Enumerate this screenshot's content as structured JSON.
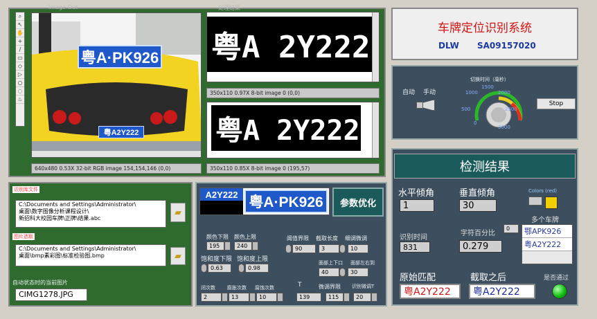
{
  "image_panel": {
    "left_title": "Image Out",
    "right_title": "处理结果",
    "left_status": "640x480 0.53X 32-bit RGB image 154,154,146    (0,0)",
    "right_top_status": "350x110 0.97X 8-bit image 0    (0,0)",
    "right_bottom_status": "350x110 0.85X 8-bit image 0    (195,57)",
    "photo_plate_text": "粤A·PK926",
    "photo_bottom_plate_text": "粤A2Y222",
    "bin_plate_top": "粤A 2Y222",
    "bin_plate_bottom": "粤A 2Y222"
  },
  "tools": [
    "⌕",
    "↖",
    "✋",
    "+",
    "/",
    "▭",
    "◇",
    "▷",
    "○",
    "◌",
    "♨"
  ],
  "title_panel": {
    "title": "车牌定位识别系统",
    "subtitle_left": "DLW",
    "subtitle_right": "SA09157020"
  },
  "control_panel": {
    "mode_auto": "自动",
    "mode_manual": "手动",
    "knob_title": "切换时间（毫秒）",
    "knob_ticks": [
      "0",
      "500",
      "1000",
      "1500",
      "2000",
      "2500",
      "3000"
    ],
    "stop_label": "Stop"
  },
  "results": {
    "header": "检测结果",
    "horizontal_angle_label": "水平倾角",
    "horizontal_angle_value": "1",
    "vertical_angle_label": "垂直倾角",
    "vertical_angle_value": "30",
    "colors_label": "Colors (red)",
    "multi_plate_label": "多个车牌",
    "multi_plates": [
      "鄂APK926",
      "粤A2Y222"
    ],
    "time_label": "识别时间",
    "time_value": "831",
    "char_pct_label": "字符百分比",
    "char_pct_value": "0.279",
    "char_pct_index": "0",
    "original_label": "原始匹配",
    "original_value": "粤A2Y222",
    "after_label": "截取之后",
    "after_value": "粤A2Y222",
    "pass_label": "是否通过"
  },
  "file_panel": {
    "library_label": "识别库文件",
    "library_path": "C:\\Documents and Settings\\Administrator\\\n桌面\\数字图像分析课程设计\\\n新招科大校园车牌\\正牌\\结果.abc",
    "image_label": "图片选取",
    "image_path": "C:\\Documents and Settings\\Administrator\\\n桌面\\bmp素彩图\\标准检验图.bmp",
    "auto_label": "自动状态时的当前图片",
    "auto_value": "CIMG1278.JPG"
  },
  "params": {
    "strip_plate_left": "A2Y222",
    "strip_plate_right": "粤A·PK926",
    "optimize_label": "参数优化",
    "color_low_label": "颜色下限",
    "color_low_value": "195",
    "color_high_label": "颜色上限",
    "color_high_value": "240",
    "threshold_label": "阈值界限",
    "threshold_value": "90",
    "cut_len_label": "截取长度",
    "cut_len_value": "3",
    "fine_tune_label": "细调微调",
    "fine_tune_value": "10",
    "sat_low_label": "饱和度下限",
    "sat_low_value": "0.63",
    "sat_high_label": "饱和度上限",
    "sat_high_value": "0.98",
    "updown_label": "面部上下口",
    "updown_value": "40",
    "leftright_label": "面部左右到",
    "leftright_value": "30",
    "close_label": "闭次数",
    "close_value": "2",
    "erode_label": "膨胀次数",
    "erode_value": "13",
    "dilate_label": "腐蚀次数",
    "dilate_value": "10",
    "t_label": "T",
    "t_value": "139",
    "tune_bound_label": "微调界限",
    "tune_bound_value": "115",
    "recog_tune_label": "识别微调T",
    "recog_tune_value": "20"
  }
}
